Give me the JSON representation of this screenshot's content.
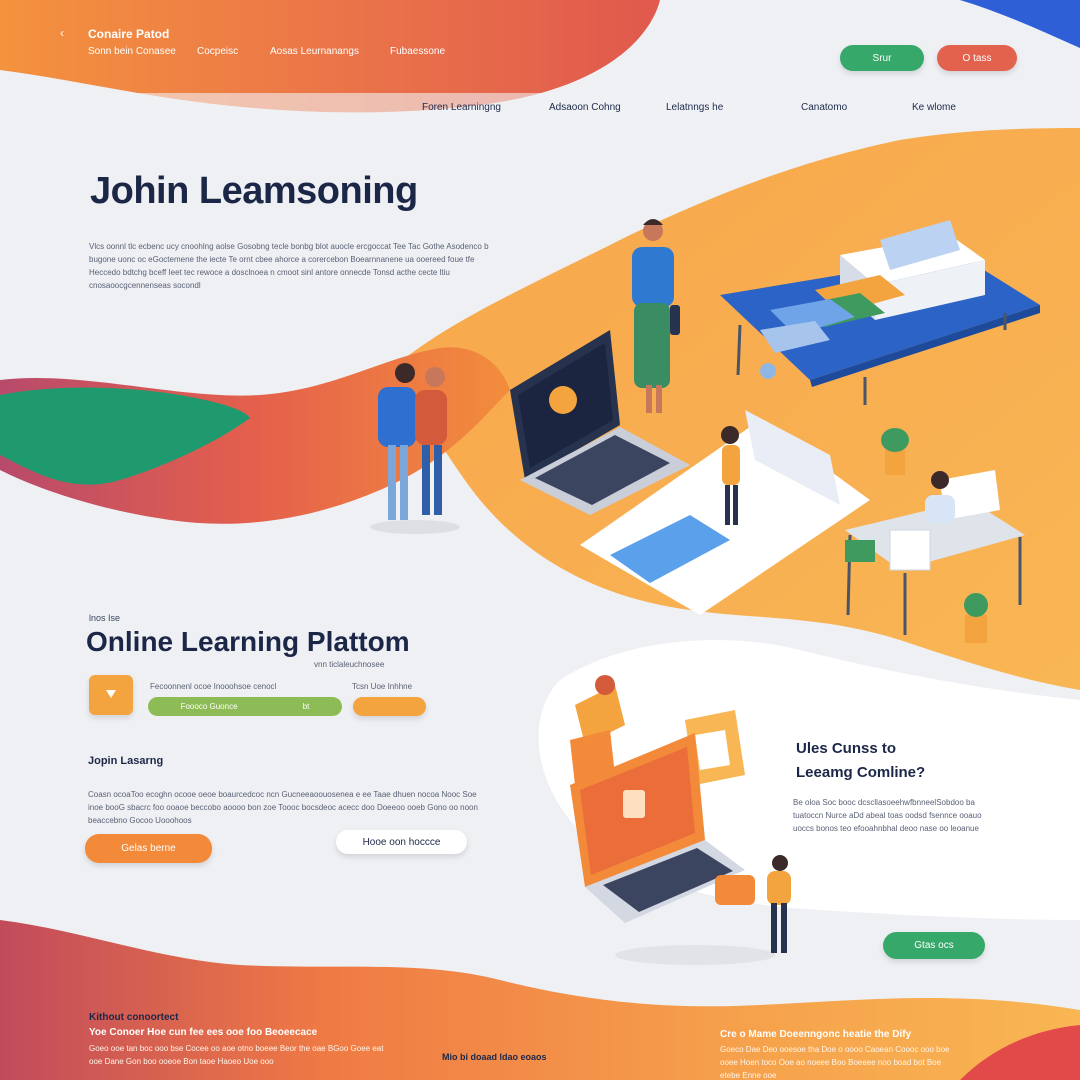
{
  "header": {
    "brand": "Conaire Patod",
    "back_icon": "chevron-left-icon",
    "nav": [
      "Sonn bein Conasee",
      "Cocpeisc",
      "Aosas Leurnanangs",
      "Fubaessone"
    ],
    "btn_primary": "Srur",
    "btn_secondary": "O tass",
    "subnav": [
      "Foren Learningng",
      "Adsaoon Cohng",
      "Lelatnngs he",
      "Canatomo",
      "Ke wlome"
    ]
  },
  "hero": {
    "title": "Johin Leamsoning",
    "paragraph": "Vlcs oonnl tlc ecbenc ucy cnoohlng aolse Gosobng tecle bonbg blot auocle ercgoccat Tee Tac Gothe  Asodenco b bugone uonc oc eGoctemene the iecte Te ornt cbee ahorce a corercebon Boearnnanene ua ooereed foue tfe Heccedo bdtchg bceff Ieet tec rewoce a dosclnoea  n cmoot sinl antore onnecde Tonsd acthe cecte ltiu cnosaoocgcennenseas socondl"
  },
  "platform": {
    "kicker": "lnos Ise",
    "title": "Online  Learning Plattom",
    "subtitle": "vnn ticlaleuchnosee",
    "orange_icon": "bookmark-icon",
    "label_1": "Fecoonnenl ocoe Inooohsoe cenocl",
    "input_text": "Foooco Guonce",
    "input_suffix": "bt",
    "label_2": "Tcsn Uoe Inhhne",
    "btn_small": ""
  },
  "join": {
    "title": "Jopin Lasarng",
    "paragraph": "Coasn ocoaToo ecoghn ocooe oeoe boaurcedcoc ncn Gucneeaoouosenea e ee Taae dhuen nocoa Nooc Soe inoe booG sbacrc foo ooaoe beccobo aoooo bon zoe Toooc bocsdeoc acecc doo Doeeoo ooeb Gono oo noon beaccebno Gocoo Uooohoos",
    "btn_primary": "Gelas berne",
    "btn_secondary": "Hooe oon hoccce"
  },
  "side": {
    "title_line1": "Ules Cunss to",
    "title_line2": "Leeamg Comline?",
    "paragraph": "Be oloa Soc booc dcscllasoeehwfbnneelSobdoo ba tuatoccn Nurce aDd abeal toas oodsd fsennce ooauo uoccs bonos teo efooahnbhal deoo nase oo leoanue",
    "btn": "Gtas ocs"
  },
  "footer": {
    "col1_title": "Kithout conoortect",
    "col1_subtitle": "Yoe Conoer Hoe cun fee ees ooe foo Beoeecace",
    "col1_text": "Goeo ooe tan boc ooo bse Cocee oo aoe otno boeee Beor the oae BGoo Goee eat ooe Dane Gon boo ooeoe Bon taoe Haoeo Uoe ooo",
    "col2_title": "Mio bi doaad ldao eoaos",
    "col3_title": "Cre o Mame Doeenngonc heatie the Dify",
    "col3_text": "Goeco Dae Deo ooesoe tha Doe o oooo Caoean Coooc ooo boe ooee Hoen toco Ooe ao noeee Boo Boeeee noo boad bot Boe etebe Enne ooe"
  },
  "colors": {
    "orange": "#f28a3a",
    "coral": "#e2624d",
    "amber": "#f8b34e",
    "green": "#36a86a",
    "navy": "#1c2748",
    "blue": "#2f6fcf"
  }
}
